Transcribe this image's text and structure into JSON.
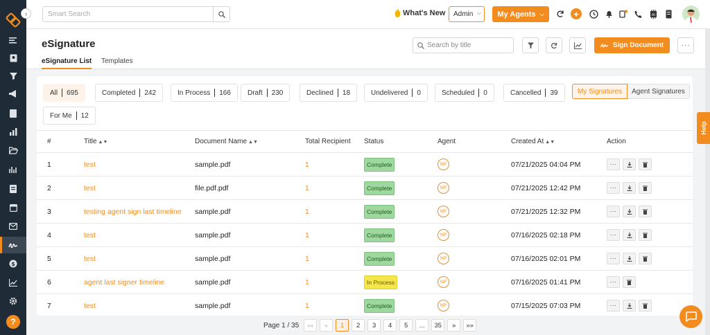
{
  "topbar": {
    "search_placeholder": "Smart Search",
    "whats_new": "What's New",
    "admin": "Admin",
    "my_agents": "My Agents"
  },
  "page": {
    "title": "eSignature",
    "tabs": [
      "eSignature List",
      "Templates"
    ],
    "search_placeholder": "Search by title",
    "sign_button": "Sign Document"
  },
  "filters": [
    {
      "label": "All",
      "count": "695"
    },
    {
      "label": "Completed",
      "count": "242"
    },
    {
      "label": "In Process",
      "count": "166"
    },
    {
      "label": "Draft",
      "count": "230"
    },
    {
      "label": "Declined",
      "count": "18"
    },
    {
      "label": "Undelivered",
      "count": "0"
    },
    {
      "label": "Scheduled",
      "count": "0"
    },
    {
      "label": "Cancelled",
      "count": "39"
    },
    {
      "label": "For Me",
      "count": "12"
    }
  ],
  "toggle": {
    "my": "My Signatures",
    "agent": "Agent Signatures"
  },
  "table": {
    "headers": [
      "#",
      "Title",
      "Document Name",
      "Total Recipient",
      "Status",
      "Agent",
      "Created At",
      "Action"
    ],
    "rows": [
      {
        "num": "1",
        "title": "test",
        "doc": "sample.pdf",
        "rec": "1",
        "status": "Complete",
        "agent": "NP",
        "created": "07/21/2025 04:04 PM"
      },
      {
        "num": "2",
        "title": "test",
        "doc": "file.pdf.pdf",
        "rec": "1",
        "status": "Complete",
        "agent": "NP",
        "created": "07/21/2025 12:42 PM"
      },
      {
        "num": "3",
        "title": "testing agent sign last timeline",
        "doc": "sample.pdf",
        "rec": "1",
        "status": "Complete",
        "agent": "NP",
        "created": "07/21/2025 12:32 PM"
      },
      {
        "num": "4",
        "title": "test",
        "doc": "sample.pdf",
        "rec": "1",
        "status": "Complete",
        "agent": "NP",
        "created": "07/16/2025 02:18 PM"
      },
      {
        "num": "5",
        "title": "test",
        "doc": "sample.pdf",
        "rec": "1",
        "status": "Complete",
        "agent": "NP",
        "created": "07/16/2025 02:01 PM"
      },
      {
        "num": "6",
        "title": "agent last signer timeline",
        "doc": "sample.pdf",
        "rec": "1",
        "status": "In Process",
        "agent": "NP",
        "created": "07/16/2025 01:41 PM"
      },
      {
        "num": "7",
        "title": "test",
        "doc": "sample.pdf",
        "rec": "1",
        "status": "Complete",
        "agent": "NP",
        "created": "07/15/2025 07:03 PM"
      }
    ]
  },
  "pager": {
    "label": "Page 1 / 35",
    "pages": [
      "1",
      "2",
      "3",
      "4",
      "5",
      "...",
      "35"
    ]
  },
  "help_tab": "Help",
  "colors": {
    "accent": "#f28c1e",
    "sidebar": "#1f2b36",
    "complete": "#9fd89f",
    "in_process": "#f6e64a"
  }
}
